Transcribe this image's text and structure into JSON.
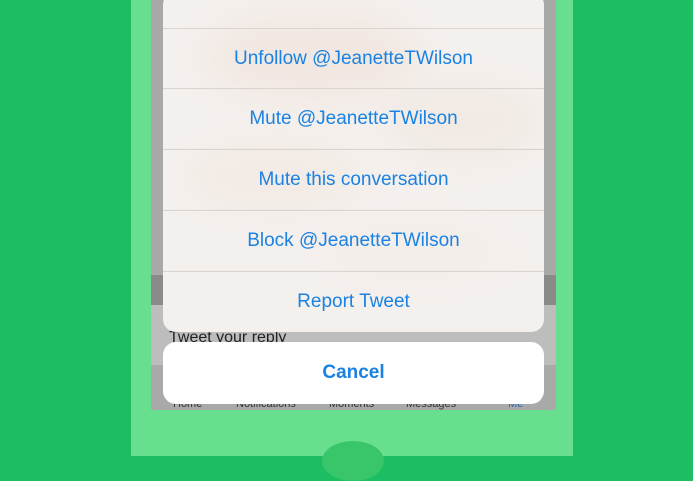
{
  "action_sheet": {
    "items": [
      {
        "label": "Unfollow @JeanetteTWilson"
      },
      {
        "label": "Mute @JeanetteTWilson"
      },
      {
        "label": "Mute this conversation"
      },
      {
        "label": "Block @JeanetteTWilson"
      },
      {
        "label": "Report Tweet"
      }
    ],
    "cancel_label": "Cancel"
  },
  "background": {
    "reply_placeholder": "Tweet your reply",
    "tabs": [
      "Home",
      "Notifications",
      "Moments",
      "Messages",
      "Me"
    ]
  },
  "colors": {
    "page_background": "#1dbe63",
    "phone_shell": "#67df8f",
    "action_text": "#1a82e2"
  }
}
